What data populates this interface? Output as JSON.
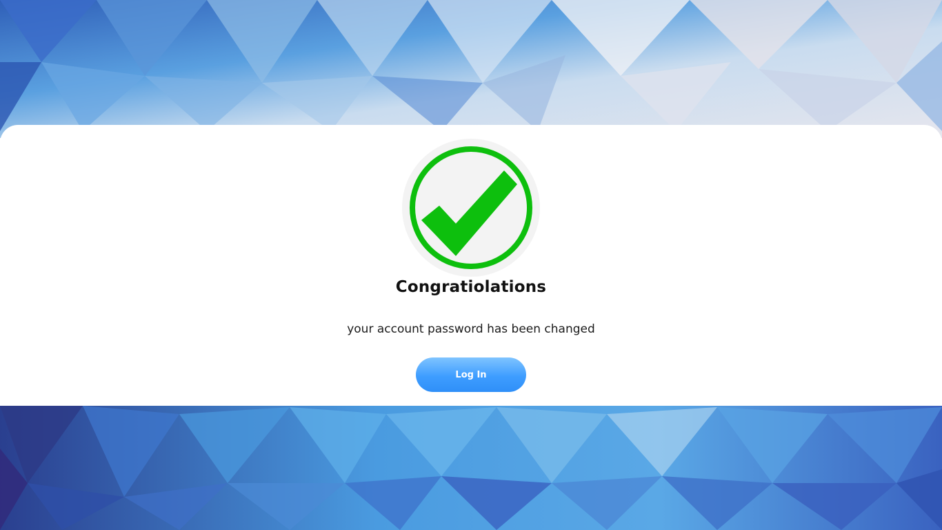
{
  "page": {
    "title": "Congratiolations",
    "message": "your account password has been changed"
  },
  "actions": {
    "login_label": "Log In"
  },
  "icons": {
    "success": "checkmark-circle-icon"
  },
  "colors": {
    "success_green": "#0dbf0d",
    "button_blue": "#3e9dff",
    "background_blue": "#3a7bd5"
  }
}
